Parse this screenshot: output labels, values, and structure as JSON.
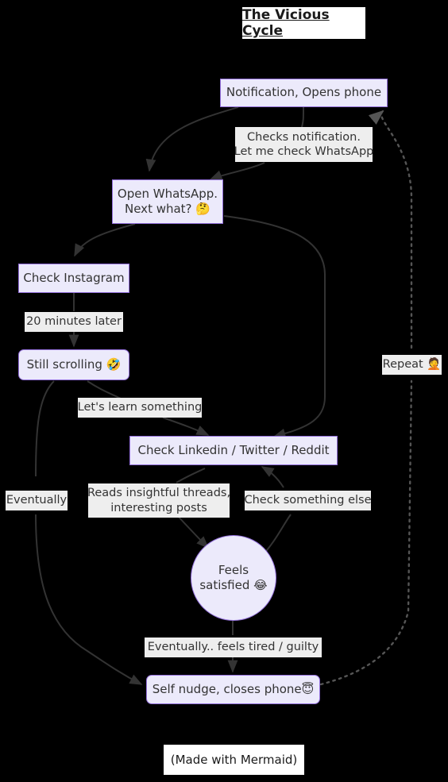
{
  "diagram": {
    "title": "The Vicious Cycle",
    "footer": "(Made with Mermaid)",
    "colors": {
      "background": "#000000",
      "node_fill": "#ECEAFB",
      "node_stroke": "#9370DB",
      "node_text": "#333333",
      "edge_stroke": "#333333",
      "edge_label_bg": "#EEEEEE",
      "title_bg": "#FFFFFF"
    },
    "nodes": [
      {
        "id": "notification",
        "label": "Notification, Opens phone",
        "shape": "rect"
      },
      {
        "id": "whatsapp",
        "label": "Open WhatsApp.\nNext what? 🤔",
        "shape": "rect"
      },
      {
        "id": "instagram",
        "label": "Check Instagram",
        "shape": "rect"
      },
      {
        "id": "scrolling",
        "label": "Still scrolling 🤣",
        "shape": "rounded"
      },
      {
        "id": "linkedin",
        "label": "Check Linkedin / Twitter / Reddit",
        "shape": "rect"
      },
      {
        "id": "satisfied",
        "label": "Feels\nsatisfied 😂",
        "shape": "circle"
      },
      {
        "id": "selfnudge",
        "label": "Self nudge, closes phone😇",
        "shape": "rounded"
      }
    ],
    "edge_labels": [
      {
        "id": "checks-notification",
        "label": "Checks notification.\nLet me check WhatsApp"
      },
      {
        "id": "twenty-minutes",
        "label": "20 minutes later"
      },
      {
        "id": "learn-something",
        "label": "Let's learn something"
      },
      {
        "id": "eventually",
        "label": "Eventually"
      },
      {
        "id": "reads-threads",
        "label": "Reads insightful threads,\ninteresting posts"
      },
      {
        "id": "check-something-else",
        "label": "Check something else"
      },
      {
        "id": "eventually-tired",
        "label": "Eventually.. feels tired / guilty"
      },
      {
        "id": "repeat",
        "label": "Repeat 🤦"
      }
    ]
  }
}
